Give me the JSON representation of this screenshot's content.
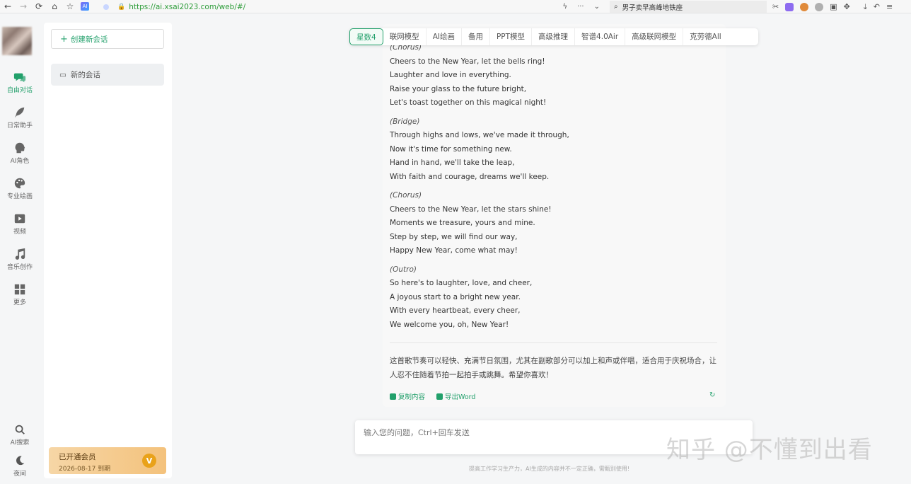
{
  "browser": {
    "url": "https://ai.xsai2023.com/web/#/",
    "search_text": "男子卖早高峰地铁座",
    "ai_badge": "AI"
  },
  "rail": {
    "items": [
      {
        "label": "自由对话",
        "icon": "chat-icon"
      },
      {
        "label": "日常助手",
        "icon": "feather-icon"
      },
      {
        "label": "AI角色",
        "icon": "avatar-head-icon"
      },
      {
        "label": "专业绘画",
        "icon": "palette-icon"
      },
      {
        "label": "视频",
        "icon": "video-icon"
      },
      {
        "label": "音乐创作",
        "icon": "music-icon"
      },
      {
        "label": "更多",
        "icon": "grid-icon"
      }
    ],
    "bottom": [
      {
        "label": "AI搜索",
        "icon": "search-icon"
      },
      {
        "label": "夜间",
        "icon": "moon-icon"
      }
    ]
  },
  "sidebar": {
    "new_chat_label": "创建新会话",
    "conversation": "新的会话",
    "member_title": "已开通会员",
    "member_expiry": "2026-08-17 到期",
    "member_badge": "V"
  },
  "tabs": [
    "星数4",
    "联网模型",
    "AI绘画",
    "备用",
    "PPT模型",
    "高级推理",
    "智谱4.0Air",
    "高级联网模型",
    "克劳德All"
  ],
  "active_tab": 0,
  "message": {
    "lines": [
      {
        "text": "(Chorus)",
        "section": true
      },
      {
        "text": "Cheers to the New Year, let the bells ring!"
      },
      {
        "text": "Laughter and love in everything."
      },
      {
        "text": "Raise your glass to the future bright,"
      },
      {
        "text": "Let's toast together on this magical night!"
      },
      {
        "text": "(Bridge)",
        "section": true
      },
      {
        "text": "Through highs and lows, we've made it through,"
      },
      {
        "text": "Now it's time for something new."
      },
      {
        "text": "Hand in hand, we'll take the leap,"
      },
      {
        "text": "With faith and courage, dreams we'll keep."
      },
      {
        "text": "(Chorus)",
        "section": true
      },
      {
        "text": "Cheers to the New Year, let the stars shine!"
      },
      {
        "text": "Moments we treasure, yours and mine."
      },
      {
        "text": "Step by step, we will find our way,"
      },
      {
        "text": "Happy New Year, come what may!"
      },
      {
        "text": "(Outro)",
        "section": true
      },
      {
        "text": "So here's to laughter, love, and cheer,"
      },
      {
        "text": "A joyous start to a bright new year."
      },
      {
        "text": "With every heartbeat, every cheer,"
      },
      {
        "text": "We welcome you, oh, New Year!"
      }
    ],
    "summary": "这首歌节奏可以轻快、充满节日氛围，尤其在副歌部分可以加上和声或伴唱，适合用于庆祝场合，让人忍不住随着节拍一起拍手或跳舞。希望你喜欢！",
    "copy_label": "复制内容",
    "export_label": "导出Word"
  },
  "input": {
    "placeholder": "输入您的问题，Ctrl+回车发送"
  },
  "footer_note": "提高工作学习生产力，AI生成的内容并不一定正确，需甄别使用!",
  "watermark": "知乎 @不懂到出看"
}
